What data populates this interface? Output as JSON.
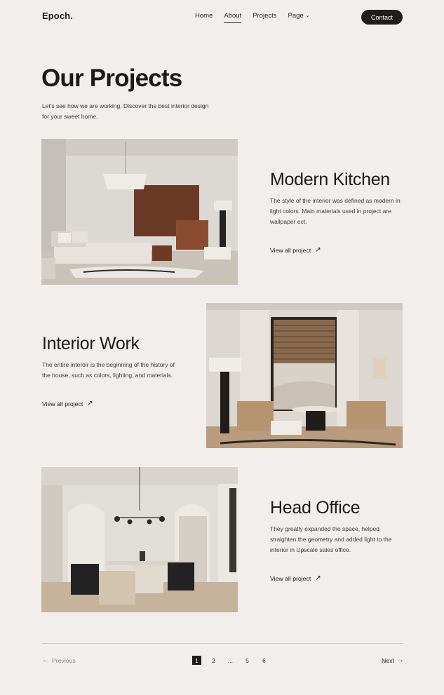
{
  "header": {
    "logo": "Epoch.",
    "nav": [
      {
        "label": "Home",
        "active": false
      },
      {
        "label": "About",
        "active": true
      },
      {
        "label": "Projects",
        "active": false
      },
      {
        "label": "Page",
        "active": false,
        "dropdown": true
      }
    ],
    "contact_label": "Contact"
  },
  "hero": {
    "title": "Our Projects",
    "intro": "Let's see how we are working. Discover the best interior design for your sweet home."
  },
  "projects": [
    {
      "title": "Modern Kitchen",
      "description": "The style of the interior was defined as modern in light colors. Main materials used in project are wallpaper ect.",
      "link_label": "View all project",
      "image": "bedroom-photo"
    },
    {
      "title": "Interior Work",
      "description": "The entire interoir is the beginning of the history of the house, such as colors, lighting, and materials.",
      "link_label": "View all project",
      "image": "living-room-photo"
    },
    {
      "title": "Head Office",
      "description": "They greatly expanded the space, helped straighten the geometry and added light to the interior in Upscale sales office.",
      "link_label": "View all project",
      "image": "dining-room-photo"
    }
  ],
  "pagination": {
    "prev_label": "Previous",
    "next_label": "Next",
    "pages": [
      "1",
      "2",
      "...",
      "5",
      "6"
    ],
    "current": "1"
  },
  "colors": {
    "background": "#f1eeeb",
    "text": "#1d1c1b",
    "accent": "#1e1e1e"
  }
}
